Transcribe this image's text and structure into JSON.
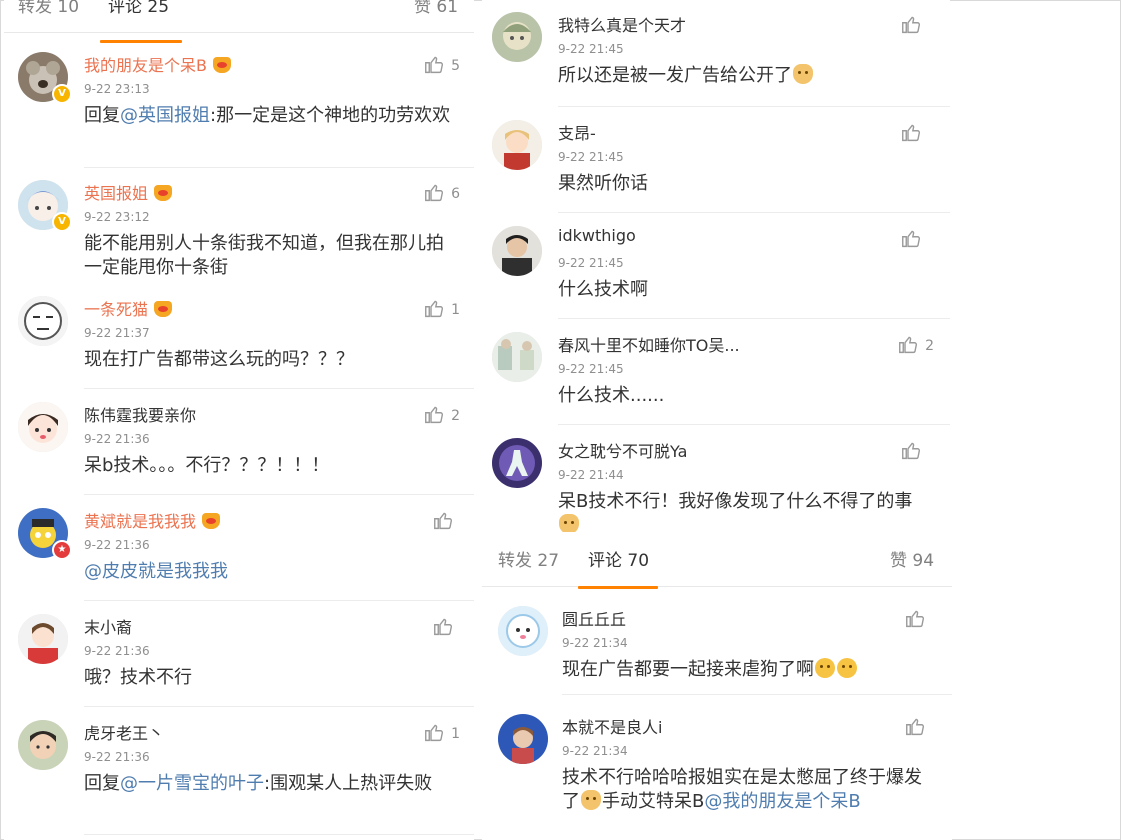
{
  "left": {
    "tabs": {
      "repost": "转发 10",
      "comments": "评论 25",
      "likes": "赞 61"
    },
    "comments": [
      {
        "name": "我的朋友是个呆B",
        "time": "9-22 23:13",
        "likes": "5",
        "reply_prefix": "回复",
        "mention": "@英国报姐",
        "text": ":那一定是这个神地的功劳欢欢"
      },
      {
        "name": "英国报姐",
        "time": "9-22 23:12",
        "likes": "6",
        "text": "能不能用别人十条街我不知道，但我在那儿拍一定能甩你十条街"
      },
      {
        "name": "一条死猫",
        "time": "9-22 21:37",
        "likes": "1",
        "text": "现在打广告都带这么玩的吗？？？"
      },
      {
        "name": "陈伟霆我要亲你",
        "time": "9-22 21:36",
        "likes": "2",
        "text": "呆b技术。。。不行？？？！！！"
      },
      {
        "name": "黄斌就是我我我",
        "time": "9-22 21:36",
        "likes": "",
        "mention": "@皮皮就是我我我"
      },
      {
        "name": "末小裔",
        "time": "9-22 21:36",
        "likes": "",
        "text": "哦？技术不行"
      },
      {
        "name": "虎牙老王丶",
        "time": "9-22 21:36",
        "likes": "1",
        "reply_prefix": "回复",
        "mention": "@一片雪宝的叶子",
        "text": ":围观某人上热评失败"
      }
    ]
  },
  "right_top": {
    "comments": [
      {
        "name": "我特么真是个天才",
        "time": "9-22 21:45",
        "likes": "",
        "text": "所以还是被一发广告给公开了"
      },
      {
        "name": "支昂-",
        "time": "9-22 21:45",
        "likes": "",
        "text": "果然听你话"
      },
      {
        "name": "idkwthigo",
        "time": "9-22 21:45",
        "likes": "",
        "text": "什么技术啊"
      },
      {
        "name": "春风十里不如睡你TO吴...",
        "time": "9-22 21:45",
        "likes": "2",
        "text": "什么技术......"
      },
      {
        "name": "女之耽兮不可脱Ya",
        "time": "9-22 21:44",
        "likes": "",
        "text": "呆B技术不行！我好像发现了什么不得了的事"
      }
    ]
  },
  "right_bottom": {
    "tabs": {
      "repost": "转发 27",
      "comments": "评论 70",
      "likes": "赞 94"
    },
    "comments": [
      {
        "name": "圆丘丘丘",
        "time": "9-22 21:34",
        "likes": "",
        "text": "现在广告都要一起接来虐狗了啊"
      },
      {
        "name": "本就不是良人i",
        "time": "9-22 21:34",
        "likes": "",
        "text": "技术不行哈哈哈报姐实在是太憋屈了终于爆发了",
        "text2": "手动艾特呆B",
        "mention": "@我的朋友是个呆B"
      }
    ]
  },
  "colors": {
    "accent": "#ff8200",
    "vip_name": "#eb7350",
    "mention": "#507daf",
    "time": "#8f8f8f"
  }
}
